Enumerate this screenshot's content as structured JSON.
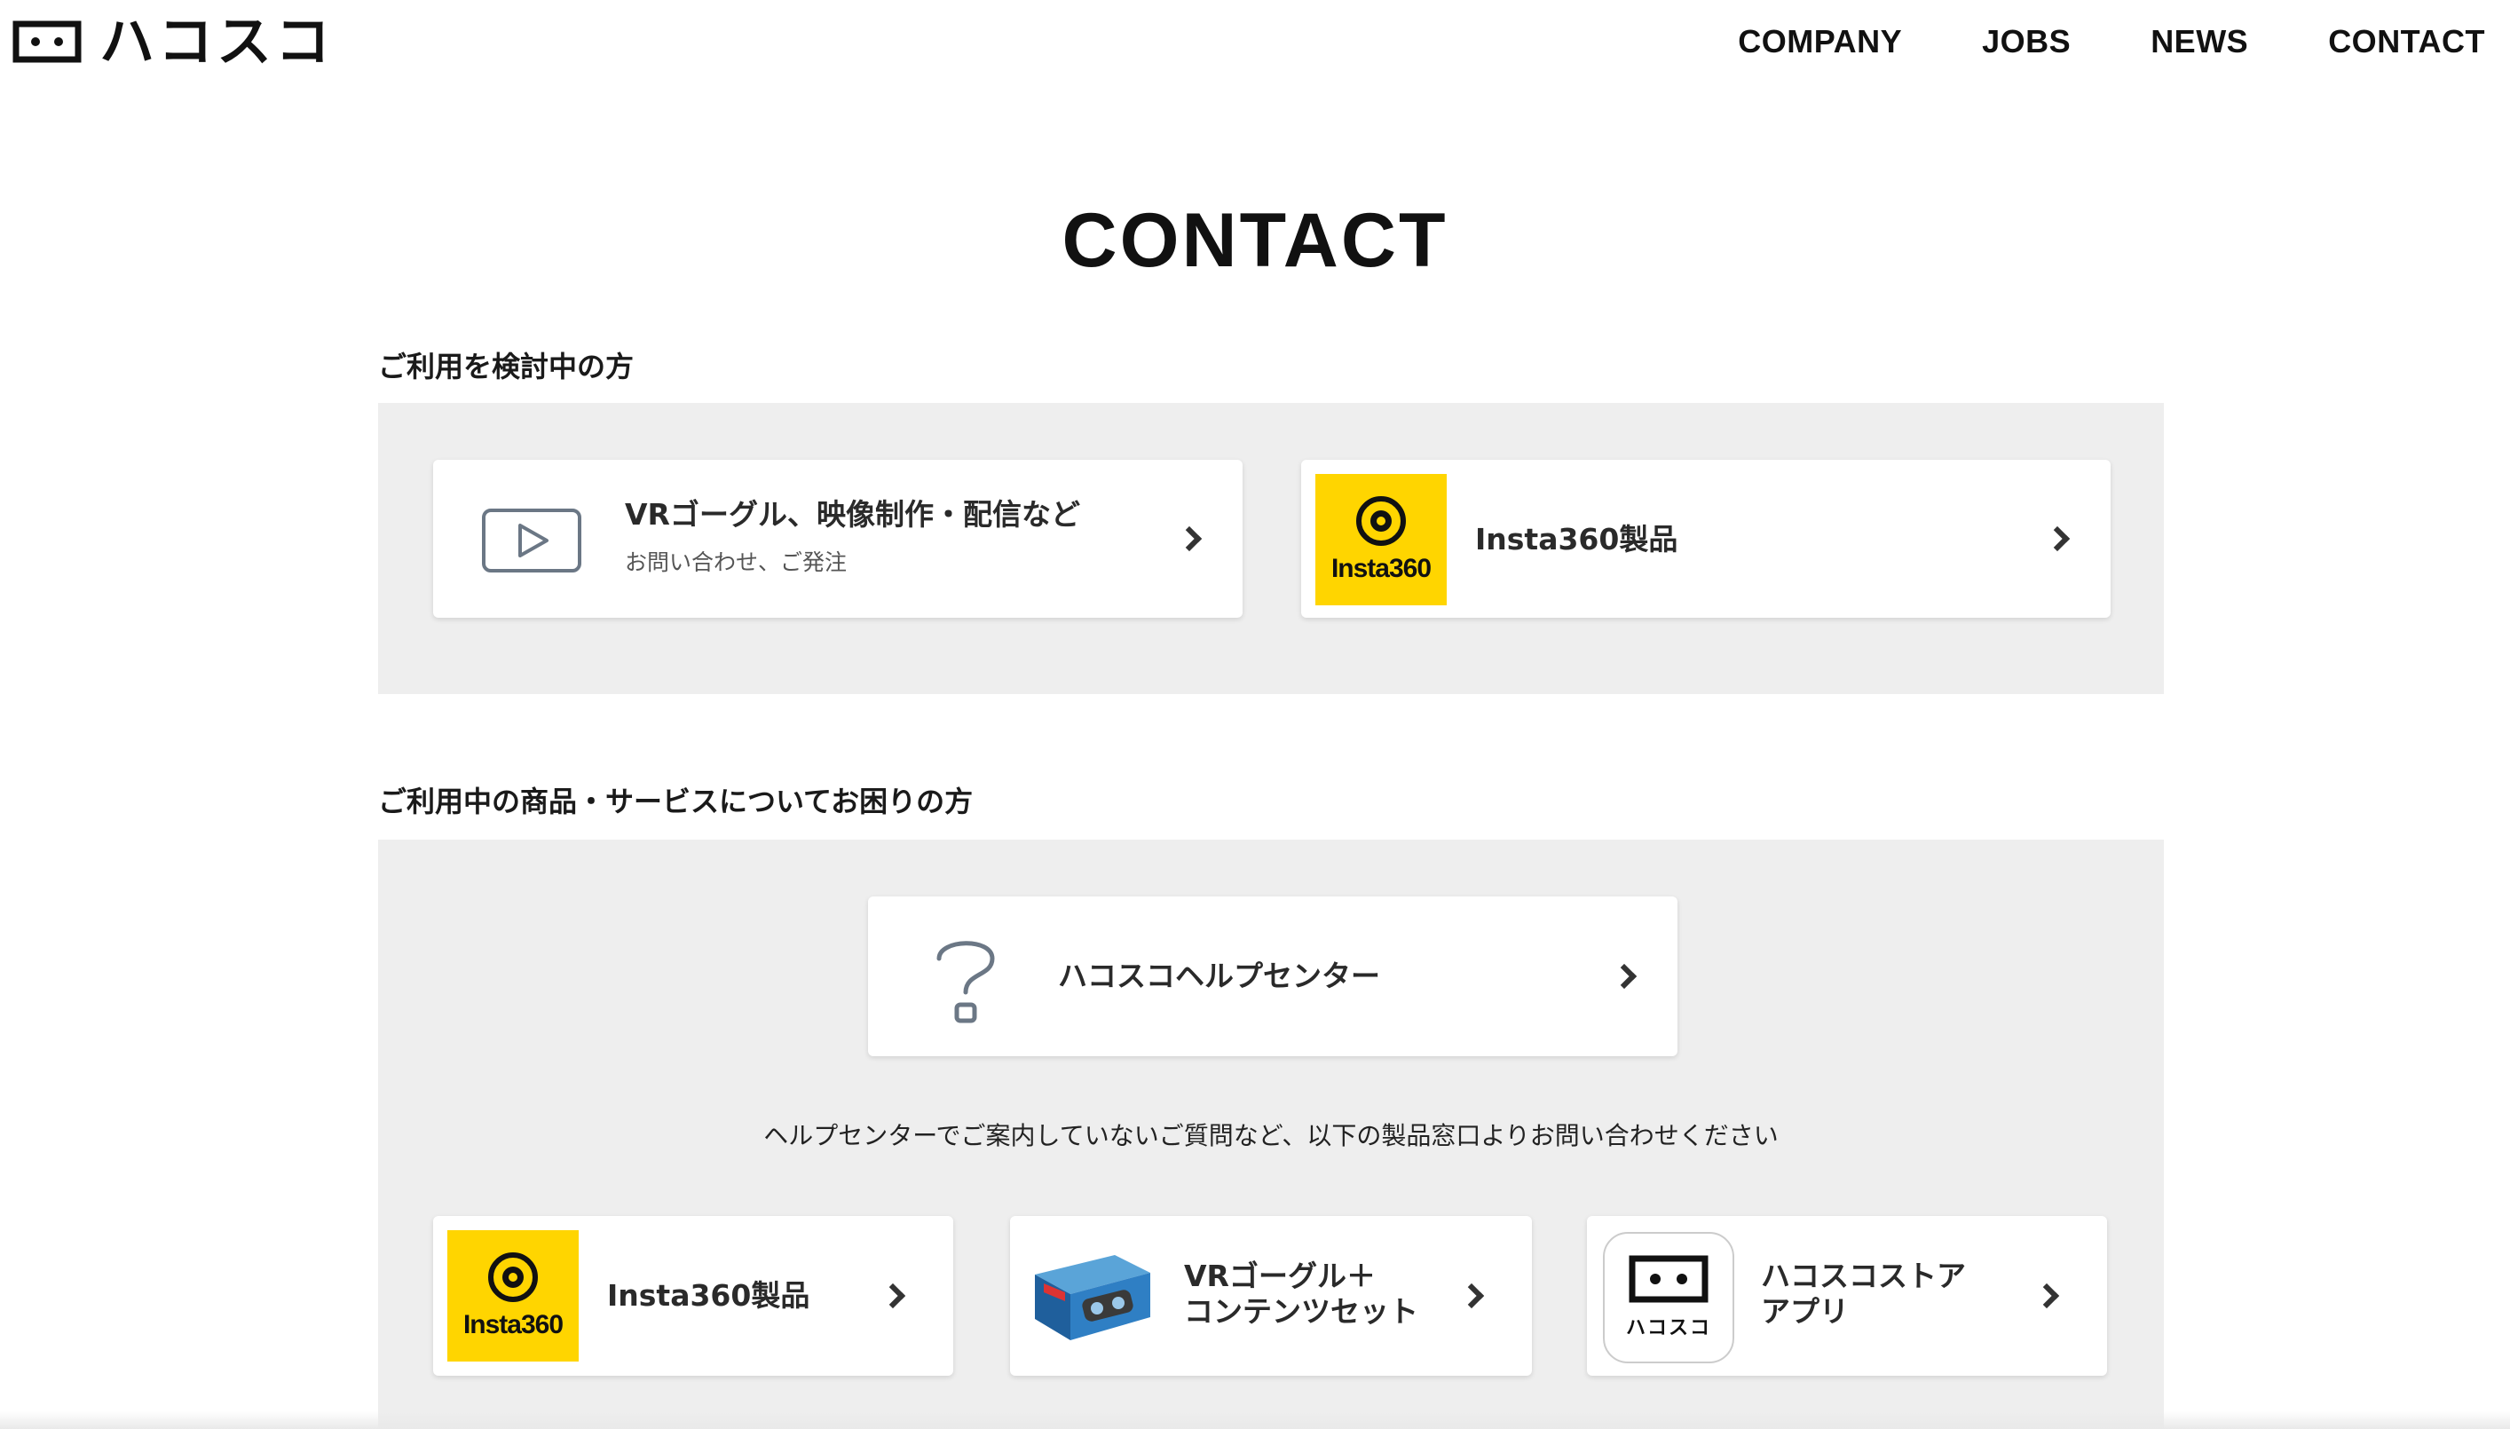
{
  "header": {
    "logo_text": "ハコスコ",
    "nav": [
      "COMPANY",
      "JOBS",
      "NEWS",
      "CONTACT"
    ]
  },
  "page": {
    "title": "CONTACT"
  },
  "section1": {
    "heading": "ご利用を検討中の方",
    "cards": [
      {
        "title": "VRゴーグル、映像制作・配信など",
        "subtitle": "お問い合わせ、ご発注",
        "icon": "video-play-icon"
      },
      {
        "title": "Insta360製品",
        "icon": "insta360-logo",
        "logo_text": "Insta360"
      }
    ]
  },
  "section2": {
    "heading": "ご利用中の商品・サービスについてお困りの方",
    "help_card": {
      "title": "ハコスコヘルプセンター",
      "icon": "question-icon"
    },
    "note": "ヘルプセンターでご案内していないご質問など、以下の製品窓口よりお問い合わせください",
    "cards": [
      {
        "title": "Insta360製品",
        "icon": "insta360-logo",
        "logo_text": "Insta360"
      },
      {
        "title_line1": "VRゴーグル＋",
        "title_line2": "コンテンツセット",
        "icon": "product-box-image"
      },
      {
        "title_line1": "ハコスコストア",
        "title_line2": "アプリ",
        "icon": "hacosco-app-icon",
        "app_label": "ハコスコ"
      }
    ]
  },
  "colors": {
    "panel_bg": "#eeeeee",
    "insta_yellow": "#ffd500",
    "text": "#1a1a1a"
  }
}
